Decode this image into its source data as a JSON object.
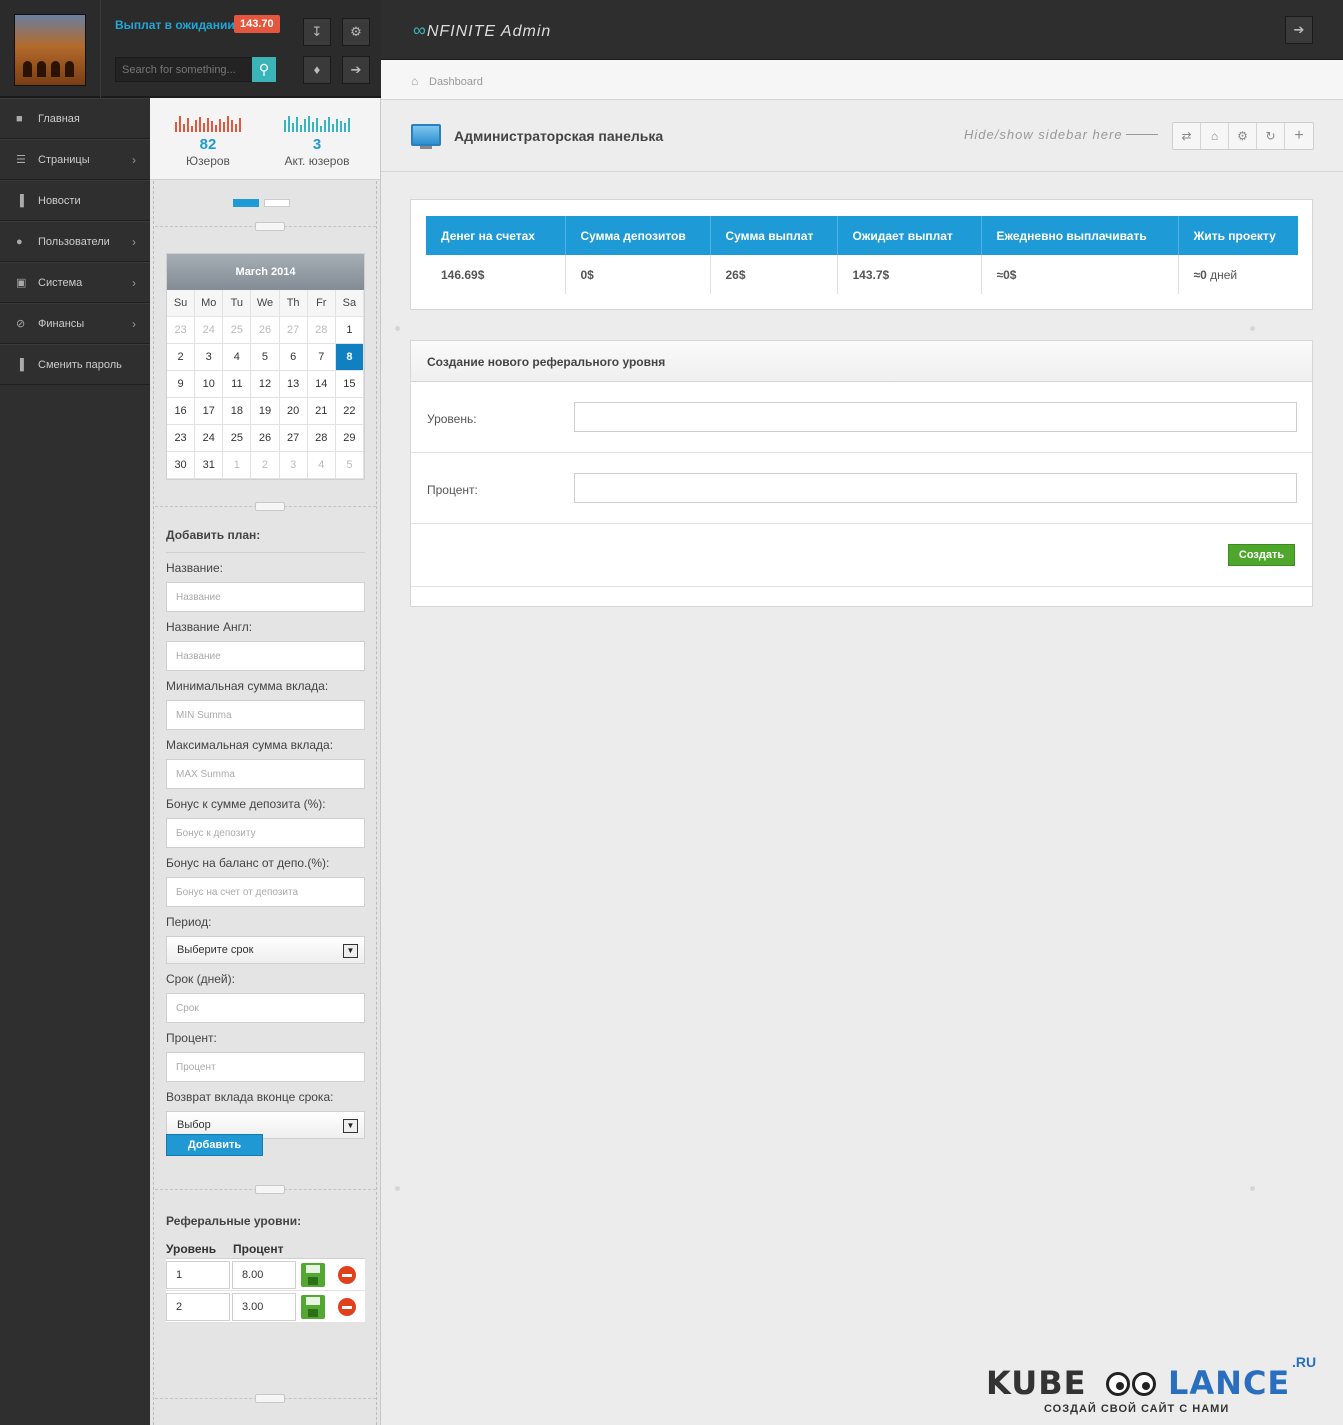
{
  "header": {
    "payout_label": "Выплат в ожидании",
    "payout_badge": "143.70",
    "search_placeholder": "Search for something...",
    "brand": "NFINITE Admin"
  },
  "nav": {
    "items": [
      {
        "label": "Главная",
        "icon": "monitor-icon",
        "has_children": false
      },
      {
        "label": "Страницы",
        "icon": "list-icon",
        "has_children": true
      },
      {
        "label": "Новости",
        "icon": "bar-chart-icon",
        "has_children": false
      },
      {
        "label": "Пользователи",
        "icon": "user-icon",
        "has_children": true
      },
      {
        "label": "Система",
        "icon": "window-icon",
        "has_children": true
      },
      {
        "label": "Финансы",
        "icon": "ban-icon",
        "has_children": true
      },
      {
        "label": "Сменить пароль",
        "icon": "bar-chart-icon",
        "has_children": false
      }
    ]
  },
  "stats": {
    "users_count": "82",
    "users_label": "Юзеров",
    "active_count": "3",
    "active_label": "Акт. юзеров",
    "colors": {
      "users": "#e5573d",
      "active": "#3ab4b9"
    }
  },
  "calendar": {
    "title": "March 2014",
    "dow": [
      "Su",
      "Mo",
      "Tu",
      "We",
      "Th",
      "Fr",
      "Sa"
    ],
    "days": [
      {
        "d": "23",
        "m": true
      },
      {
        "d": "24",
        "m": true
      },
      {
        "d": "25",
        "m": true
      },
      {
        "d": "26",
        "m": true
      },
      {
        "d": "27",
        "m": true
      },
      {
        "d": "28",
        "m": true
      },
      {
        "d": "1"
      },
      {
        "d": "2"
      },
      {
        "d": "3"
      },
      {
        "d": "4"
      },
      {
        "d": "5"
      },
      {
        "d": "6"
      },
      {
        "d": "7"
      },
      {
        "d": "8",
        "today": true
      },
      {
        "d": "9"
      },
      {
        "d": "10"
      },
      {
        "d": "11"
      },
      {
        "d": "12"
      },
      {
        "d": "13"
      },
      {
        "d": "14"
      },
      {
        "d": "15"
      },
      {
        "d": "16"
      },
      {
        "d": "17"
      },
      {
        "d": "18"
      },
      {
        "d": "19"
      },
      {
        "d": "20"
      },
      {
        "d": "21"
      },
      {
        "d": "22"
      },
      {
        "d": "23"
      },
      {
        "d": "24"
      },
      {
        "d": "25"
      },
      {
        "d": "26"
      },
      {
        "d": "27"
      },
      {
        "d": "28"
      },
      {
        "d": "29"
      },
      {
        "d": "30"
      },
      {
        "d": "31"
      },
      {
        "d": "1",
        "m": true
      },
      {
        "d": "2",
        "m": true
      },
      {
        "d": "3",
        "m": true
      },
      {
        "d": "4",
        "m": true
      },
      {
        "d": "5",
        "m": true
      }
    ]
  },
  "plan_form": {
    "title": "Добавить план:",
    "fields": [
      {
        "label": "Название:",
        "placeholder": "Название",
        "type": "input"
      },
      {
        "label": "Название Англ:",
        "placeholder": "Название",
        "type": "input"
      },
      {
        "label": "Минимальная сумма вклада:",
        "placeholder": "MIN Summa",
        "type": "input"
      },
      {
        "label": "Максимальная сумма вклада:",
        "placeholder": "MAX Summa",
        "type": "input"
      },
      {
        "label": "Бонус к сумме депозита (%):",
        "placeholder": "Бонус к депозиту",
        "type": "input"
      },
      {
        "label": "Бонус на баланс от депо.(%):",
        "placeholder": "Бонус на счет от депозита",
        "type": "input"
      },
      {
        "label": "Период:",
        "placeholder": "Выберите срок",
        "type": "select"
      },
      {
        "label": "Срок (дней):",
        "placeholder": "Срок",
        "type": "input"
      },
      {
        "label": "Процент:",
        "placeholder": "Процент",
        "type": "input"
      },
      {
        "label": "Возврат вклада вконце срока:",
        "placeholder": "Выбор",
        "type": "select"
      }
    ],
    "submit_label": "Добавить"
  },
  "ref_levels": {
    "title": "Реферальные уровни:",
    "col_level": "Уровень",
    "col_percent": "Процент",
    "rows": [
      {
        "level": "1",
        "percent": "8.00"
      },
      {
        "level": "2",
        "percent": "3.00"
      }
    ]
  },
  "main": {
    "breadcrumb": "Dashboard",
    "page_title": "Администраторская панелька",
    "sidebar_hint": "Hide/show sidebar here",
    "stats_table": {
      "headers": [
        "Денег на счетах",
        "Сумма депозитов",
        "Сумма выплат",
        "Ожидает выплат",
        "Ежедневно выплачивать",
        "Жить проекту"
      ],
      "values": [
        "146.69$",
        "0$",
        "26$",
        "143.7$",
        "≈0$",
        "≈0"
      ],
      "last_suffix": " дней"
    },
    "ref_form": {
      "title": "Создание нового реферального уровня",
      "level_label": "Уровень:",
      "percent_label": "Процент:",
      "submit_label": "Создать"
    }
  },
  "watermark": {
    "left": "KUBE",
    "right": "LANCE",
    "tld": ".RU",
    "tagline": "СОЗДАЙ СВОЙ САЙТ С НАМИ"
  }
}
